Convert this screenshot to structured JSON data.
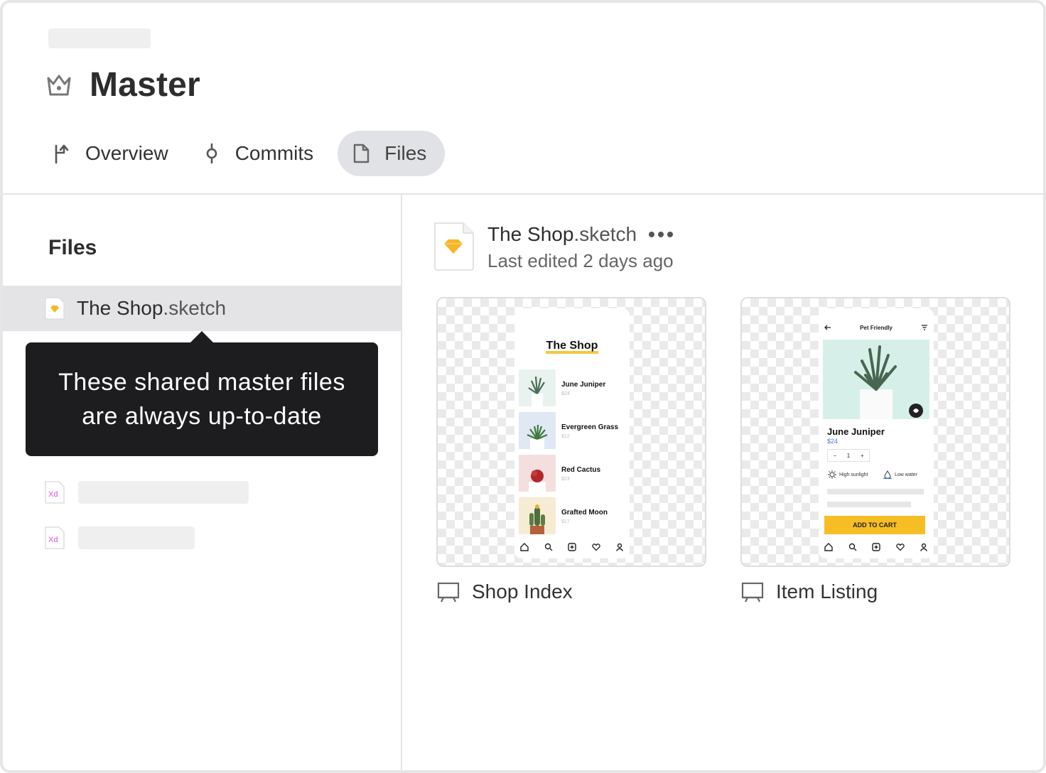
{
  "project": {
    "title": "Master",
    "tabs": [
      {
        "label": "Overview",
        "icon": "branch-up-icon"
      },
      {
        "label": "Commits",
        "icon": "commit-icon"
      },
      {
        "label": "Files",
        "icon": "file-icon",
        "active": true
      }
    ]
  },
  "sidebar": {
    "heading": "Files",
    "selected_file": {
      "name": "The Shop",
      "ext": ".sketch",
      "icon": "sketch-file-icon"
    },
    "other_files": [
      {
        "icon": "xd-file-icon",
        "icon_text": "Xd"
      },
      {
        "icon": "xd-file-icon",
        "icon_text": "Xd"
      }
    ],
    "tooltip": {
      "line1": "These shared master files",
      "line2": "are always up-to-date"
    }
  },
  "main": {
    "file": {
      "name": "The Shop",
      "ext": ".sketch",
      "subtitle": "Last edited 2 days ago"
    },
    "artboards": [
      {
        "caption": "Shop Index",
        "preview": {
          "title": "The Shop",
          "items": [
            {
              "name": "June Juniper",
              "price": "$24"
            },
            {
              "name": "Evergreen Grass",
              "price": "$12"
            },
            {
              "name": "Red Cactus",
              "price": "$23"
            },
            {
              "name": "Grafted Moon",
              "price": "$17"
            }
          ]
        }
      },
      {
        "caption": "Item Listing",
        "preview": {
          "top_title": "Pet Friendly",
          "name": "June Juniper",
          "price": "$24",
          "qty": "1",
          "qty_minus": "−",
          "qty_plus": "+",
          "attr1": "High sunlight",
          "attr2": "Low water",
          "cta": "ADD TO CART"
        }
      }
    ]
  },
  "colors": {
    "sketch_yellow": "#f7b528",
    "xd_pink": "#e24fd6",
    "tooltip_bg": "#1d1d1f",
    "active_tab_bg": "#e1e2e5",
    "cart_yellow": "#f6bd24"
  }
}
